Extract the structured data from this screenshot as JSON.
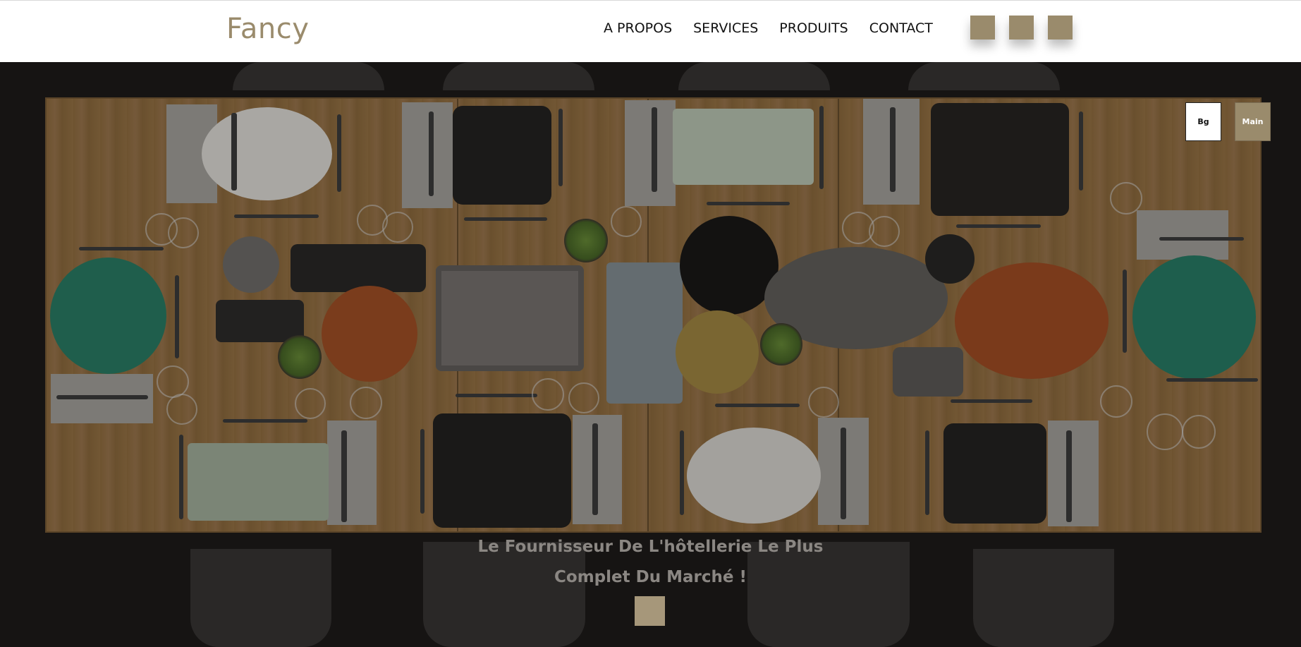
{
  "header": {
    "logo": "Fancy",
    "nav": [
      {
        "label": "A PROPOS"
      },
      {
        "label": "SERVICES"
      },
      {
        "label": "PRODUITS"
      },
      {
        "label": "CONTACT"
      }
    ],
    "social_icons": [
      "social-icon-1",
      "social-icon-2",
      "social-icon-3"
    ]
  },
  "hero": {
    "tagline_line1": "Le Fournisseur De L'hôtellerie Le Plus",
    "tagline_line2": "Complet Du Marché !",
    "scroll_button_icon": "square-icon"
  },
  "theme_toggles": {
    "bg_label": "Bg",
    "main_label": "Main"
  },
  "colors": {
    "accent": "#9a8b6c",
    "overlay": "#161413"
  }
}
